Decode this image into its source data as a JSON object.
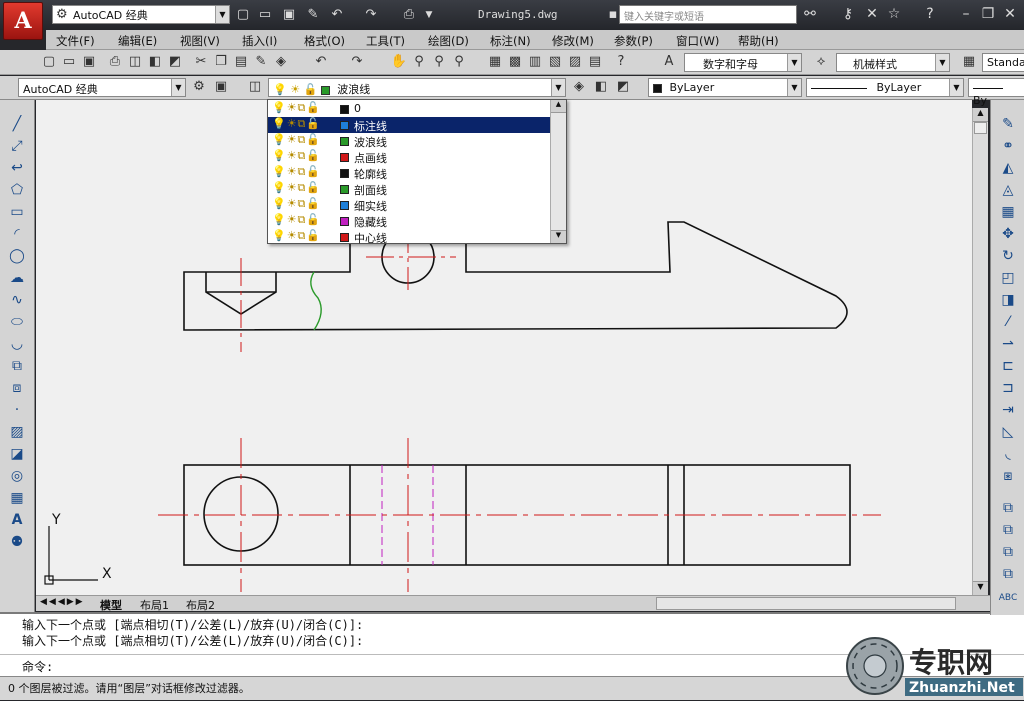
{
  "app": {
    "workspace": "AutoCAD 经典",
    "document_title": "Drawing5.dwg",
    "search_placeholder": "键入关键字或短语",
    "logo_letter": "A"
  },
  "menubar": [
    "文件(F)",
    "编辑(E)",
    "视图(V)",
    "插入(I)",
    "格式(O)",
    "工具(T)",
    "绘图(D)",
    "标注(N)",
    "修改(M)",
    "参数(P)",
    "窗口(W)",
    "帮助(H)"
  ],
  "toolbar1": {
    "text_style": "数字和字母",
    "dim_style": "机械样式",
    "table_style": "Standa"
  },
  "toolbar2": {
    "workspace_combo": "AutoCAD 经典",
    "current_layer": "波浪线",
    "color": "ByLayer",
    "linetype": "ByLayer",
    "lineweight": "By"
  },
  "layer_dropdown": {
    "items": [
      {
        "name": "0",
        "color": "#111111"
      },
      {
        "name": "标注线",
        "color": "#1e7fd8"
      },
      {
        "name": "波浪线",
        "color": "#2a9a2a"
      },
      {
        "name": "点画线",
        "color": "#d01818"
      },
      {
        "name": "轮廓线",
        "color": "#111111"
      },
      {
        "name": "剖面线",
        "color": "#2a9a2a"
      },
      {
        "name": "细实线",
        "color": "#1e7fd8"
      },
      {
        "name": "隐藏线",
        "color": "#c020c0"
      },
      {
        "name": "中心线",
        "color": "#d01818"
      }
    ],
    "selected_index": 1
  },
  "tabs": [
    "模型",
    "布局1",
    "布局2"
  ],
  "command": {
    "history": [
      "输入下一个点或 [端点相切(T)/公差(L)/放弃(U)/闭合(C)]:",
      "输入下一个点或 [端点相切(T)/公差(L)/放弃(U)/闭合(C)]:"
    ],
    "prompt": "命令:"
  },
  "status_text": "0 个图层被过滤。请用“图层”对话框修改过滤器。",
  "ucs": {
    "x_label": "X",
    "y_label": "Y"
  },
  "watermark": {
    "text": "专职网",
    "url_text": "Zhuanzhi.Net"
  },
  "colors": {
    "outline": "#111111",
    "center": "#d01818",
    "hidden": "#c020c0",
    "wave": "#2a9a2a"
  }
}
